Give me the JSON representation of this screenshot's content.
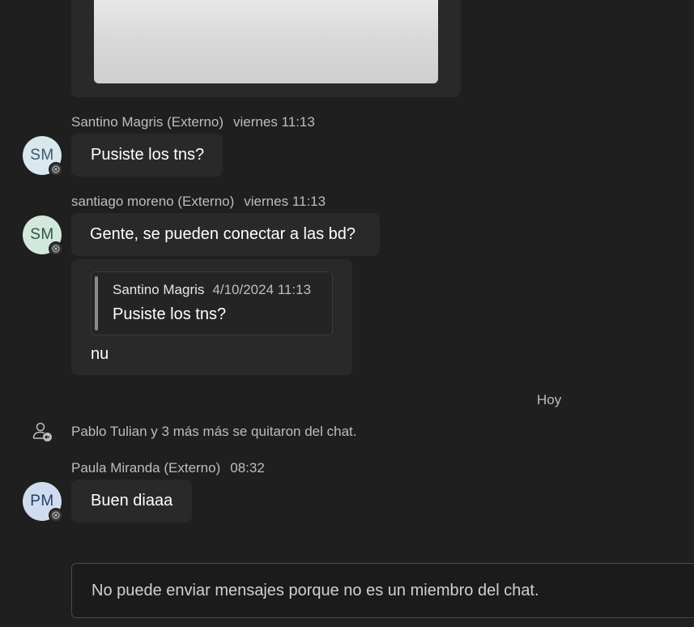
{
  "messages": [
    {
      "author": "Santino Magris (Externo)",
      "time": "viernes 11:13",
      "initials": "SM",
      "text": "Pusiste los tns?"
    },
    {
      "author": "santiago moreno (Externo)",
      "time": "viernes 11:13",
      "initials": "SM",
      "text": "Gente, se pueden conectar a las bd?",
      "reply": {
        "quote_author": "Santino Magris",
        "quote_date": "4/10/2024 11:13",
        "quote_text": "Pusiste los tns?",
        "text": "nu"
      }
    },
    {
      "author": "Paula Miranda (Externo)",
      "time": "08:32",
      "initials": "PM",
      "text": "Buen diaaa"
    }
  ],
  "divider": {
    "label": "Hoy"
  },
  "system_event": {
    "icon": "person-removed-icon",
    "text": "Pablo Tulian y 3 más más se quitaron del chat."
  },
  "composer": {
    "notice": "No puede enviar mensajes porque no es un miembro del chat."
  },
  "colors": {
    "background": "#1f1f1f",
    "bubble": "#292929",
    "meta_text": "#bdbdbd"
  }
}
